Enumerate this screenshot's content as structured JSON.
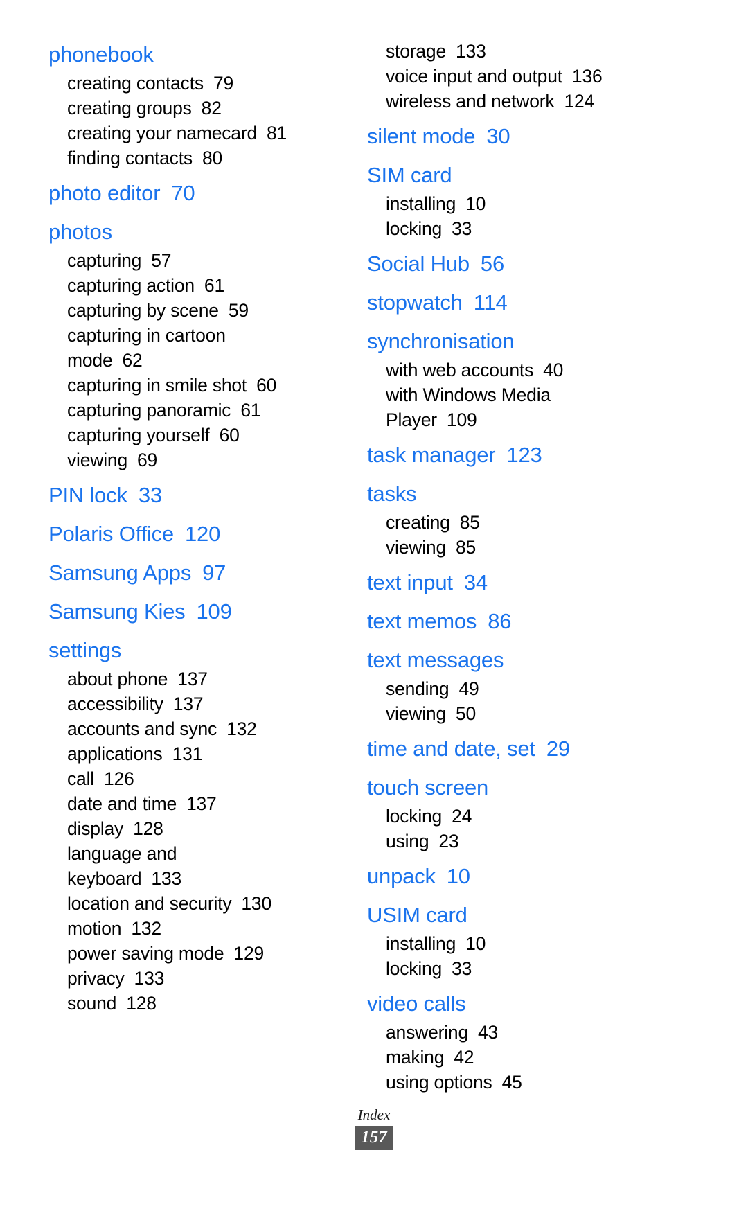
{
  "document": {
    "type": "index",
    "footer_label": "Index",
    "page_number": "157",
    "heading_color": "#1a73ed",
    "badge_background": "#595959",
    "badge_text_color": "#ffffff"
  },
  "columns": [
    {
      "id": "left",
      "groups": [
        {
          "head": "phonebook",
          "head_page": "",
          "subs": [
            {
              "label": "creating contacts",
              "page": "79"
            },
            {
              "label": "creating groups",
              "page": "82"
            },
            {
              "label": "creating your namecard",
              "page": "81"
            },
            {
              "label": "finding contacts",
              "page": "80"
            }
          ]
        },
        {
          "head": "photo editor",
          "head_page": "70",
          "subs": []
        },
        {
          "head": "photos",
          "head_page": "",
          "subs": [
            {
              "label": "capturing",
              "page": "57"
            },
            {
              "label": "capturing action",
              "page": "61"
            },
            {
              "label": "capturing by scene",
              "page": "59"
            },
            {
              "label": "capturing in cartoon",
              "page": ""
            },
            {
              "label": "mode",
              "page": "62"
            },
            {
              "label": "capturing in smile shot",
              "page": "60"
            },
            {
              "label": "capturing panoramic",
              "page": "61"
            },
            {
              "label": "capturing yourself",
              "page": "60"
            },
            {
              "label": "viewing",
              "page": "69"
            }
          ]
        },
        {
          "head": "PIN lock",
          "head_page": "33",
          "subs": []
        },
        {
          "head": "Polaris Office",
          "head_page": "120",
          "subs": []
        },
        {
          "head": "Samsung Apps",
          "head_page": "97",
          "subs": []
        },
        {
          "head": "Samsung Kies",
          "head_page": "109",
          "subs": []
        },
        {
          "head": "settings",
          "head_page": "",
          "subs": [
            {
              "label": "about phone",
              "page": "137"
            },
            {
              "label": "accessibility",
              "page": "137"
            },
            {
              "label": "accounts and sync",
              "page": "132"
            },
            {
              "label": "applications",
              "page": "131"
            },
            {
              "label": "call",
              "page": "126"
            },
            {
              "label": "date and time",
              "page": "137"
            },
            {
              "label": "display",
              "page": "128"
            },
            {
              "label": "language and",
              "page": ""
            },
            {
              "label": "keyboard",
              "page": "133"
            },
            {
              "label": "location and security",
              "page": "130"
            },
            {
              "label": "motion",
              "page": "132"
            },
            {
              "label": "power saving mode",
              "page": "129"
            },
            {
              "label": "privacy",
              "page": "133"
            },
            {
              "label": "sound",
              "page": "128"
            }
          ]
        }
      ]
    },
    {
      "id": "right",
      "groups": [
        {
          "head": "",
          "head_page": "",
          "subs": [
            {
              "label": "storage",
              "page": "133"
            },
            {
              "label": "voice input and output",
              "page": "136"
            },
            {
              "label": "wireless and network",
              "page": "124"
            }
          ]
        },
        {
          "head": "silent mode",
          "head_page": "30",
          "subs": []
        },
        {
          "head": "SIM card",
          "head_page": "",
          "subs": [
            {
              "label": "installing",
              "page": "10"
            },
            {
              "label": "locking",
              "page": "33"
            }
          ]
        },
        {
          "head": "Social Hub",
          "head_page": "56",
          "subs": []
        },
        {
          "head": "stopwatch",
          "head_page": "114",
          "subs": []
        },
        {
          "head": "synchronisation",
          "head_page": "",
          "subs": [
            {
              "label": "with web accounts",
              "page": "40"
            },
            {
              "label": "with Windows Media",
              "page": ""
            },
            {
              "label": "Player",
              "page": "109"
            }
          ]
        },
        {
          "head": "task manager",
          "head_page": "123",
          "subs": []
        },
        {
          "head": "tasks",
          "head_page": "",
          "subs": [
            {
              "label": "creating",
              "page": "85"
            },
            {
              "label": "viewing",
              "page": "85"
            }
          ]
        },
        {
          "head": "text input",
          "head_page": "34",
          "subs": []
        },
        {
          "head": "text memos",
          "head_page": "86",
          "subs": []
        },
        {
          "head": "text messages",
          "head_page": "",
          "subs": [
            {
              "label": "sending",
              "page": "49"
            },
            {
              "label": "viewing",
              "page": "50"
            }
          ]
        },
        {
          "head": "time and date, set",
          "head_page": "29",
          "subs": []
        },
        {
          "head": "touch screen",
          "head_page": "",
          "subs": [
            {
              "label": "locking",
              "page": "24"
            },
            {
              "label": "using",
              "page": "23"
            }
          ]
        },
        {
          "head": "unpack",
          "head_page": "10",
          "subs": []
        },
        {
          "head": "USIM card",
          "head_page": "",
          "subs": [
            {
              "label": "installing",
              "page": "10"
            },
            {
              "label": "locking",
              "page": "33"
            }
          ]
        },
        {
          "head": "video calls",
          "head_page": "",
          "subs": [
            {
              "label": "answering",
              "page": "43"
            },
            {
              "label": "making",
              "page": "42"
            },
            {
              "label": "using options",
              "page": "45"
            }
          ]
        }
      ]
    }
  ]
}
